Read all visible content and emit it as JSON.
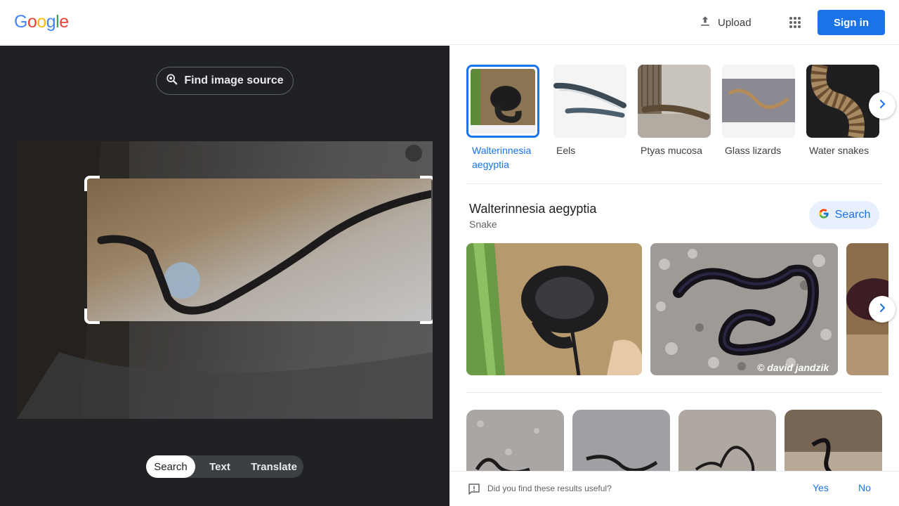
{
  "header": {
    "logo": [
      "G",
      "o",
      "o",
      "g",
      "l",
      "e"
    ],
    "logo_colors": [
      "#4285F4",
      "#EA4335",
      "#FBBC05",
      "#4285F4",
      "#34A853",
      "#EA4335"
    ],
    "upload_label": "Upload",
    "signin_label": "Sign in"
  },
  "left": {
    "find_source_label": "Find image source",
    "tabs": [
      {
        "label": "Search",
        "active": true
      },
      {
        "label": "Text",
        "active": false
      },
      {
        "label": "Translate",
        "active": false
      }
    ]
  },
  "related": [
    {
      "label": "Walterinnesia aegyptia",
      "selected": true
    },
    {
      "label": "Eels",
      "selected": false
    },
    {
      "label": "Ptyas mucosa",
      "selected": false
    },
    {
      "label": "Glass lizards",
      "selected": false
    },
    {
      "label": "Water snakes",
      "selected": false
    }
  ],
  "entity": {
    "title": "Walterinnesia aegyptia",
    "subtitle": "Snake",
    "search_label": "Search"
  },
  "results": {
    "watermark": "© david jandzik"
  },
  "feedback": {
    "question": "Did you find these results useful?",
    "yes": "Yes",
    "no": "No"
  },
  "colors": {
    "accent": "#1a73e8",
    "dark_pane": "#202124"
  }
}
